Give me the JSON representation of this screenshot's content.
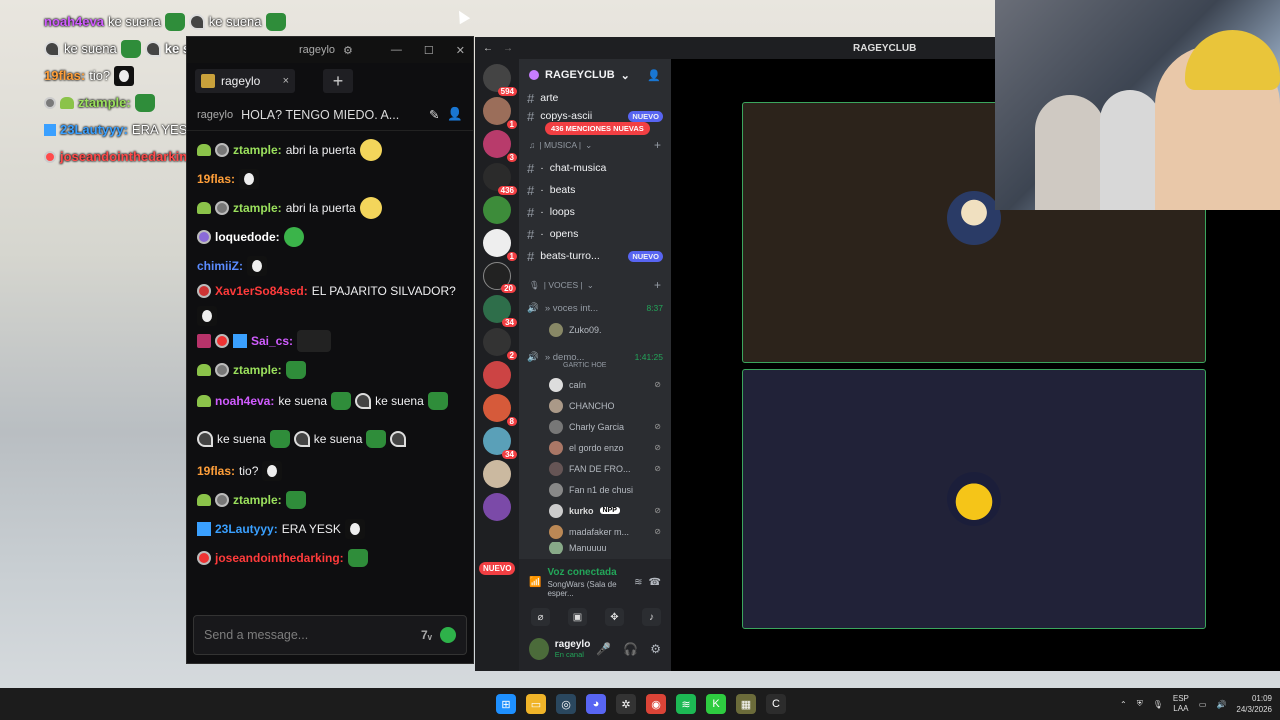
{
  "overlay": {
    "lines": [
      {
        "user": "noah4eva",
        "text": "ke suena",
        "text2": "ke suena",
        "color": "#d05cff"
      },
      {
        "user": "",
        "text": "ke suena",
        "text2": "ke suena",
        "color": "#ffffff"
      },
      {
        "user": "19flas:",
        "text": "tio?",
        "color": "#ff9f3a"
      },
      {
        "user": "ztample:",
        "text": "",
        "color": "#9be15d"
      },
      {
        "user": "23Lautyyy:",
        "text": "ERA YESK",
        "color": "#3aa0ff"
      },
      {
        "user": "joseandointhedarking:",
        "text": "",
        "color": "#ff4b4b"
      }
    ]
  },
  "twitch": {
    "window_title": "rageylo",
    "tab_label": "rageylo",
    "tab_close": "×",
    "add_tab": "+",
    "stream_title": "HOLA? TENGO MIEDO. A...",
    "channel": "rageylo",
    "messages": [
      {
        "user": "ztample:",
        "color": "#9be15d",
        "text": "abri la puerta"
      },
      {
        "user": "19flas:",
        "color": "#ff9f3a",
        "text": ""
      },
      {
        "user": "ztample:",
        "color": "#9be15d",
        "text": "abri la puerta"
      },
      {
        "user": "loquedode:",
        "color": "#ffffff",
        "text": ""
      },
      {
        "user": "chimiiZ:",
        "color": "#5b8cff",
        "text": ""
      },
      {
        "user": "Xav1erSo84sed:",
        "color": "#ff3b3b",
        "text": "EL PAJARITO SILVADOR?"
      },
      {
        "user": "Sai_cs:",
        "color": "#d05cff",
        "text": ""
      },
      {
        "user": "ztample:",
        "color": "#9be15d",
        "text": ""
      },
      {
        "user": "noah4eva:",
        "color": "#d05cff",
        "text": "ke suena",
        "text2": "ke suena",
        "text3": "ke suena",
        "text4": "ke suena"
      },
      {
        "user": "19flas:",
        "color": "#ff9f3a",
        "text": "tio?"
      },
      {
        "user": "ztample:",
        "color": "#9be15d",
        "text": ""
      },
      {
        "user": "23Lautyyy:",
        "color": "#3aa0ff",
        "text": "ERA YESK"
      },
      {
        "user": "joseandointhedarking:",
        "color": "#ff3b3b",
        "text": ""
      }
    ],
    "input_placeholder": "Send a message..."
  },
  "discord": {
    "title_server": "RAGEYCLUB",
    "server_name": "RAGEYCLUB",
    "mentions": "436 MENCIONES NUEVAS",
    "rail_badges": [
      "594",
      "1",
      "3",
      "436",
      "",
      "1",
      "20",
      "34",
      "2",
      "",
      "8",
      "34",
      "",
      "",
      "25"
    ],
    "rail_nuevo": "NUEVO",
    "channels_top": [
      {
        "name": "arte",
        "badge": ""
      },
      {
        "name": "copys-ascii",
        "badge": "NUEVO"
      }
    ],
    "musica_category": "| MUSICA |",
    "musica_channels": [
      {
        "name": "chat-musica"
      },
      {
        "name": "beats"
      },
      {
        "name": "loops"
      },
      {
        "name": "opens"
      },
      {
        "name": "beats-turro...",
        "badge": "NUEVO"
      }
    ],
    "voces_category": "| VOCES |",
    "voice1": {
      "name": "» voces int...",
      "time": "8:37",
      "users": [
        "Zuko09."
      ]
    },
    "voice2": {
      "name": "» demo...",
      "time": "1:41:25",
      "sub": "GARTIC HOE",
      "users": [
        "caín",
        "CHANCHO",
        "Charly Garcia",
        "el gordo enzo",
        "FAN DE FRO...",
        "Fan n1 de chusi",
        "kurko",
        "madafaker m...",
        "Manuuuu"
      ]
    },
    "npp_tag": "NPP",
    "voice_connected": "Voz conectada",
    "voice_channel": "SongWars (Sala de esper...",
    "username": "rageylo",
    "user_status": "En canal"
  },
  "taskbar": {
    "lang_top": "ESP",
    "lang_bottom": "LAA",
    "time": "01:09",
    "date": "24/3/2026"
  }
}
